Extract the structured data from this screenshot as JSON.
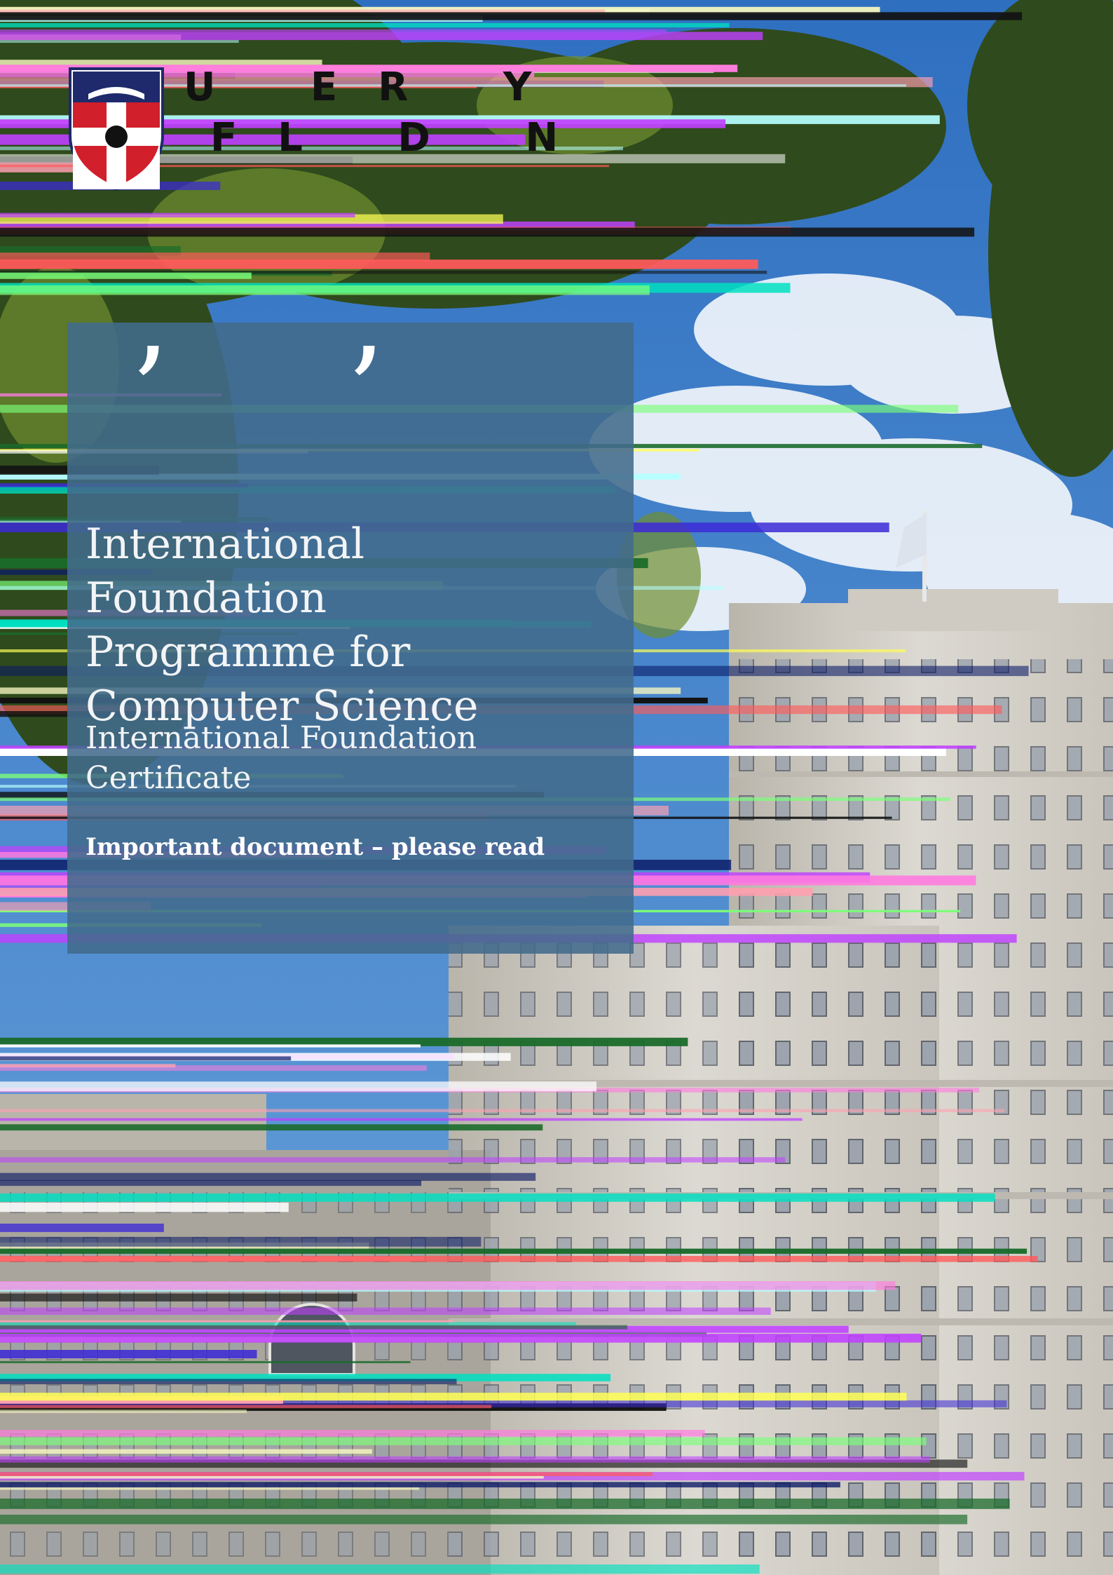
{
  "logo": {
    "line1": "U ER Y",
    "line2": "FL D N",
    "shield_icon": "university-shield-icon"
  },
  "cover": {
    "quote_marks": "’ ’",
    "title_lines": [
      "International Foundation",
      "Programme for",
      "Computer Science"
    ],
    "subtitle_lines": [
      "International Foundation",
      "Certificate"
    ],
    "notice": "Important document – please read"
  },
  "colors": {
    "panel": "#426b8c",
    "sky": "#4a86c9",
    "building": "#d7d4cc",
    "shield_red": "#d11f2c",
    "shield_navy": "#1e2a6b"
  }
}
